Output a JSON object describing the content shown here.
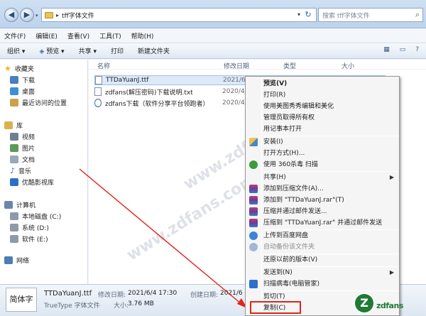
{
  "window": {
    "address_folder": "tff字体文件",
    "search_placeholder": "搜索 tff字体文件"
  },
  "menubar": [
    {
      "label": "文件(F)"
    },
    {
      "label": "编辑(E)"
    },
    {
      "label": "查看(V)"
    },
    {
      "label": "工具(T)"
    },
    {
      "label": "帮助(H)"
    }
  ],
  "toolbar": {
    "organize": "组织 ▾",
    "preview": "预览 ▾",
    "share": "共享 ▾",
    "print": "打印",
    "new_folder": "新建文件夹"
  },
  "sidebar": {
    "favorites": "收藏夹",
    "downloads": "下载",
    "desktop": "桌面",
    "recent": "最近访问的位置",
    "libraries": "库",
    "videos": "视频",
    "pictures": "图片",
    "documents": "文档",
    "music": "音乐",
    "youku": "优酷影视库",
    "computer": "计算机",
    "disk_c": "本地磁盘 (C:)",
    "disk_d": "系统 (D:)",
    "disk_e": "软件 (E:)",
    "network": "网络"
  },
  "columns": {
    "name": "名称",
    "modified": "修改日期",
    "type": "类型",
    "size": "大小"
  },
  "files": [
    {
      "name": "TTDaYuanJ.ttf",
      "date": "2021/6/4"
    },
    {
      "name": "zdfans(解压密码)下载说明.txt",
      "date": "2020/4/"
    },
    {
      "name": "zdfans下载（软件分享平台领跑者）",
      "date": "2020/4/"
    }
  ],
  "details": {
    "thumb_text": "简体字",
    "filename": "TTDaYuanJ.ttf",
    "modified_label": "修改日期:",
    "modified_value": "2021/6/4 17:30",
    "created_label": "创建日期:",
    "created_value": "2021/6",
    "filetype": "TrueType 字体文件",
    "size_label": "大小:",
    "size_value": "3.76 MB"
  },
  "context_menu": {
    "preview": "预览(V)",
    "print": "打印(R)",
    "meitu": "使用美图秀秀编辑和美化",
    "takeown": "管理员取得所有权",
    "notepad": "用记事本打开",
    "install": "安装(I)",
    "open_with": "打开方式(H)...",
    "scan360": "使用 360杀毒 扫描",
    "share": "共享(H)",
    "add_archive": "添加到压缩文件(A)...",
    "add_rar": "添加到 \"TTDaYuanJ.rar\"(T)",
    "compress_email": "压缩并通过邮件发送...",
    "compress_rar_email": "压缩到 \"TTDaYuanJ.rar\" 并通过邮件发送",
    "baidu_upload": "上传到百度网盘",
    "baidu_auto": "自动备份该文件夹",
    "restore": "还原以前的版本(V)",
    "send_to": "发送到(N)",
    "virus_scan": "扫描病毒(电脑管家)",
    "cut": "剪切(T)",
    "copy": "复制(C)"
  },
  "watermark": "www.zdfans.com",
  "logo": {
    "mark": "Z",
    "text": "zdfans"
  },
  "colors": {
    "accent": "#e3241b",
    "selection": "#dbe9f8",
    "logo": "#1f7a35"
  }
}
